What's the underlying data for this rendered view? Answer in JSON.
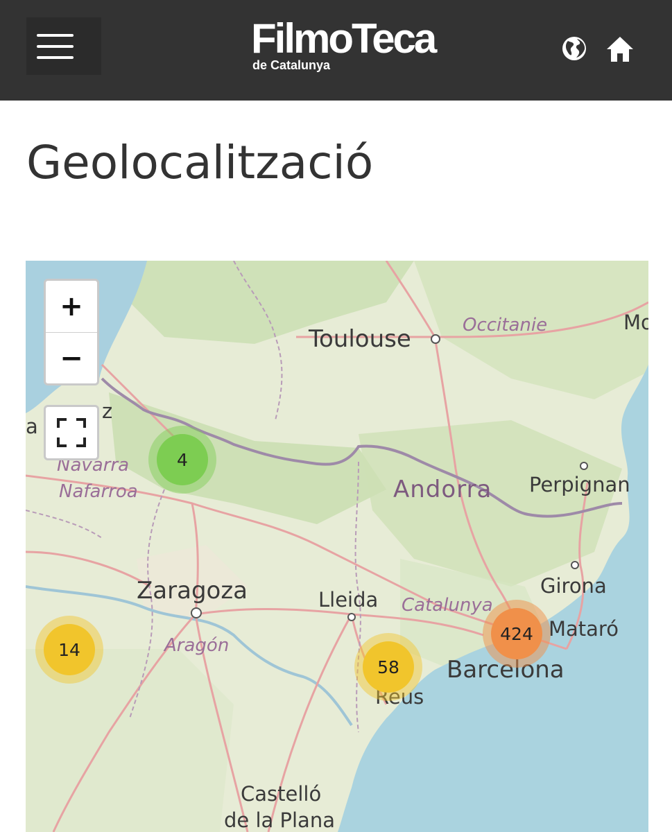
{
  "header": {
    "menu_icon": "hamburger-menu-icon",
    "logo_main": "FilmoTeca",
    "logo_sub": "de Catalunya",
    "language_icon": "globe-icon",
    "home_icon": "home-icon",
    "bar_color": "#333333"
  },
  "page": {
    "title": "Geolocalització"
  },
  "map": {
    "controls": {
      "zoom_in": "+",
      "zoom_out": "−",
      "fullscreen_icon": "fullscreen-icon"
    },
    "labels": {
      "toulouse": "Toulouse",
      "occitanie": "Occitanie",
      "mo": "Mo",
      "bayonne_partial": "a",
      "bayonne_partial_z": "z",
      "navarra": "Navarra",
      "nafarroa": "Nafarroa",
      "andorra": "Andorra",
      "perpignan": "Perpignan",
      "zaragoza": "Zaragoza",
      "aragon": "Aragón",
      "lleida": "Lleida",
      "catalunya": "Catalunya",
      "girona": "Girona",
      "mataro": "Mataró",
      "barcelona": "Barcelona",
      "reus": "Reus",
      "castello_1": "Castelló",
      "castello_2": "de la Plana"
    },
    "clusters": [
      {
        "id": "navarra",
        "count": "4",
        "level": "small",
        "color": "#7dcd52"
      },
      {
        "id": "west",
        "count": "14",
        "level": "medium",
        "color": "#f1c52c"
      },
      {
        "id": "reus",
        "count": "58",
        "level": "medium",
        "color": "#f1c52c"
      },
      {
        "id": "barcelona",
        "count": "424",
        "level": "large",
        "color": "#f0904a"
      }
    ]
  }
}
